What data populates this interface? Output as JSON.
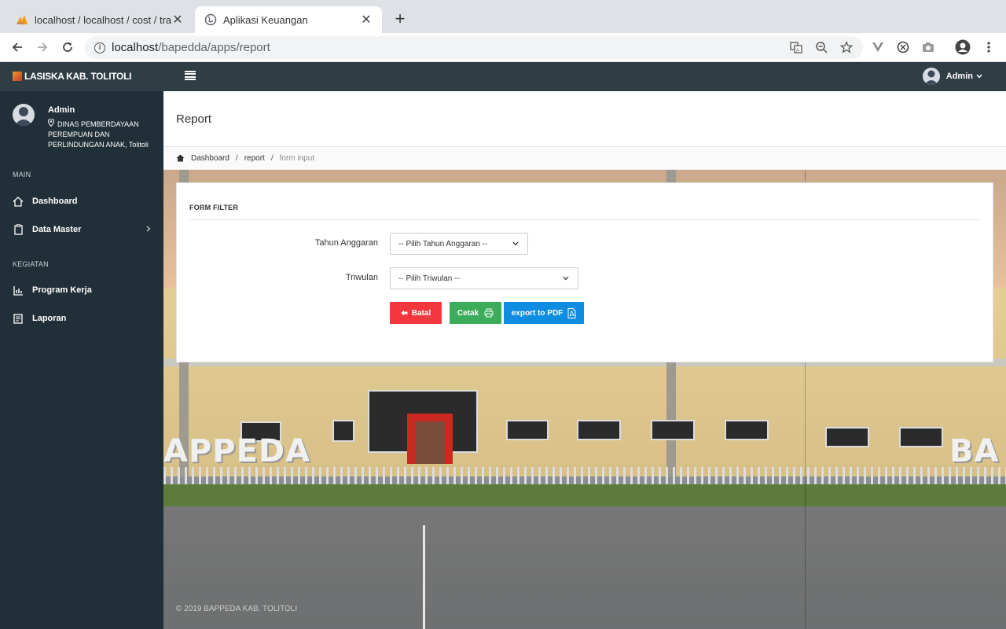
{
  "browser": {
    "tabs": [
      {
        "title": "localhost / localhost / cost / tra",
        "active": false
      },
      {
        "title": "Aplikasi Keuangan",
        "active": true
      }
    ],
    "new_tab_label": "+",
    "close_label": "✕",
    "url_host": "localhost",
    "url_path": "/bapedda/apps/report"
  },
  "header": {
    "brand": "LASISKA KAB. TOLITOLI",
    "user": "Admin"
  },
  "sidebar": {
    "user_name": "Admin",
    "user_org": "DINAS PEMBERDAYAAN PEREMPUAN DAN PERLINDUNGAN ANAK, Tolitoli",
    "sections": [
      {
        "title": "MAIN",
        "items": [
          {
            "label": "Dashboard",
            "icon": "home-icon"
          },
          {
            "label": "Data Master",
            "icon": "clipboard-icon",
            "has_submenu": true
          }
        ]
      },
      {
        "title": "KEGIATAN",
        "items": [
          {
            "label": "Program Kerja",
            "icon": "chart-icon"
          },
          {
            "label": "Laporan",
            "icon": "report-icon"
          }
        ]
      }
    ]
  },
  "page": {
    "title": "Report",
    "breadcrumb": [
      "Dashboard",
      "report",
      "form input"
    ]
  },
  "background_sign": {
    "left": "APPEDA",
    "right": "BA"
  },
  "form": {
    "title": "FORM FILTER",
    "fields": [
      {
        "label": "Tahun Anggaran",
        "value": "-- Pilih Tahun Anggaran --"
      },
      {
        "label": "Triwulan",
        "value": "-- Pilih Triwulan --"
      }
    ],
    "buttons": {
      "cancel": "Batal",
      "print": "Cetak",
      "pdf": "export to PDF"
    }
  },
  "footer": "© 2019 BAPPEDA KAB. TOLITOLI",
  "colors": {
    "header_bg": "#2f3d45",
    "sidebar_bg": "#213038",
    "danger": "#f2373f",
    "success": "#3bad5a",
    "primary": "#0f8de0"
  }
}
